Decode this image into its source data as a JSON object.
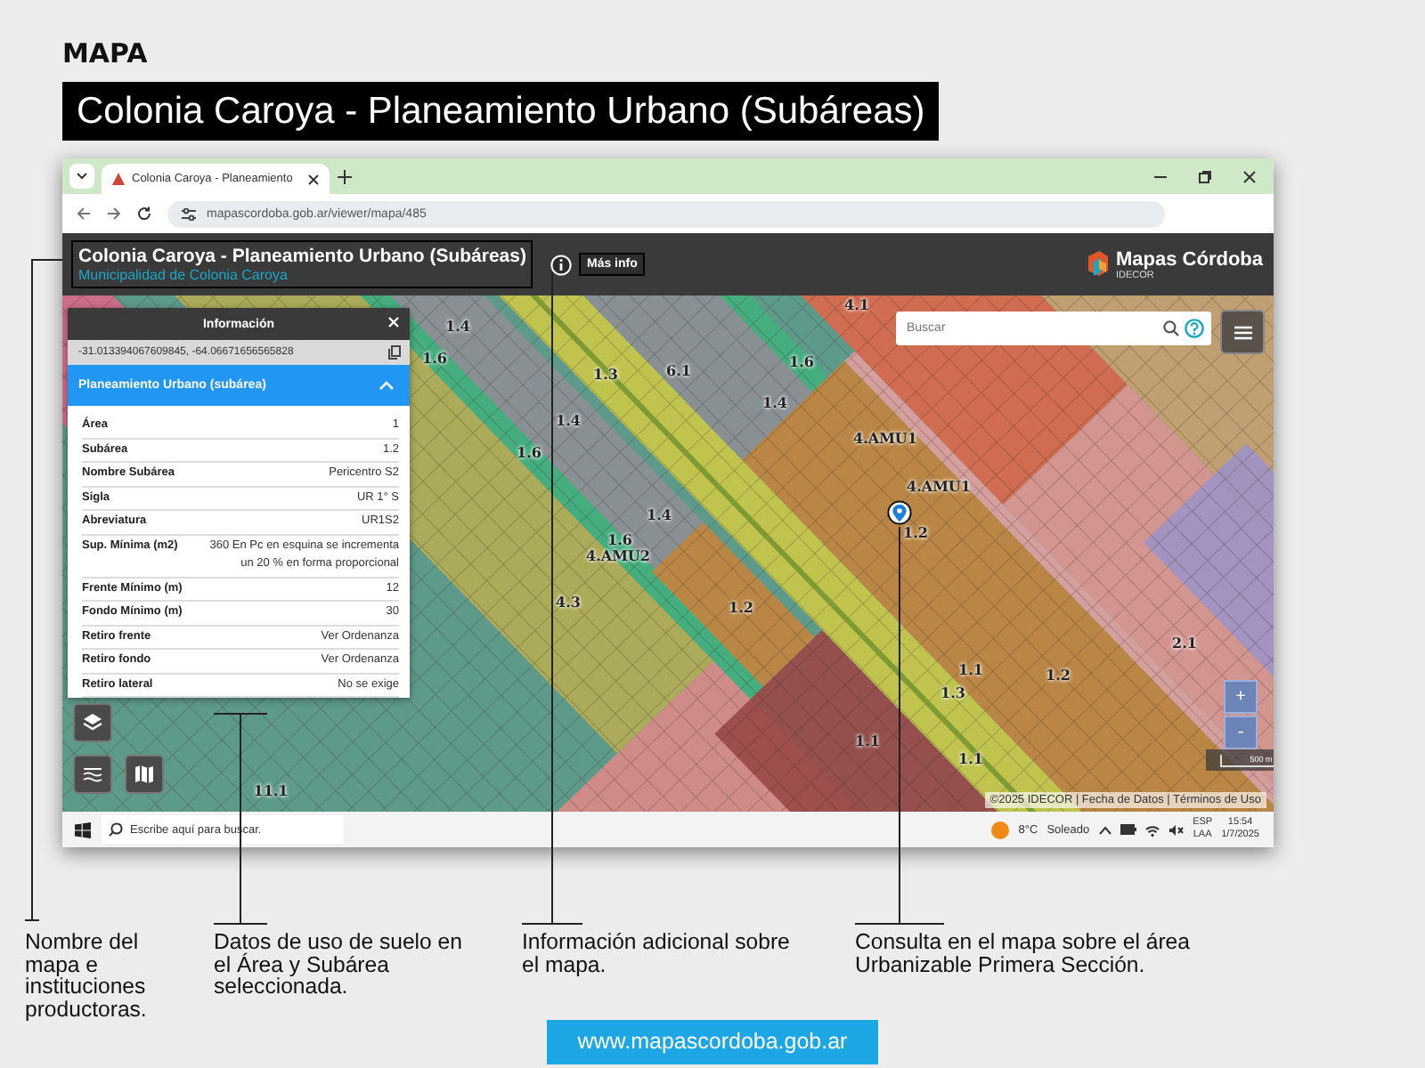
{
  "heading": "MAPA",
  "banner": "Colonia Caroya - Planeamiento Urbano (Subáreas)",
  "browser": {
    "tab": {
      "title": "Colonia Caroya - Planeamiento"
    },
    "url": "mapascordoba.gob.ar/viewer/mapa/485"
  },
  "app": {
    "title": "Colonia Caroya - Planeamiento Urbano (Subáreas)",
    "subtitle": "Municipalidad de Colonia Caroya",
    "more_info": "Más info",
    "logo": {
      "name": "Mapas Córdoba",
      "sub": "IDECOR"
    }
  },
  "info_panel": {
    "title": "Información",
    "coordinates": "-31.013394067609845, -64.06671656565828",
    "section": {
      "title": "Planeamiento Urbano (subárea)",
      "expanded": true
    },
    "rows": [
      {
        "label": "Área",
        "value": "1"
      },
      {
        "label": "Subárea",
        "value": "1.2"
      },
      {
        "label": "Nombre Subárea",
        "value": "Pericentro S2"
      },
      {
        "label": "Sigla",
        "value": "UR 1° S"
      },
      {
        "label": "Abreviatura",
        "value": "UR1S2"
      },
      {
        "label": "Sup. Mínima (m2)",
        "value": "360 En Pc en esquina se incrementa un 20 % en forma proporcional"
      },
      {
        "label": "Frente Mínimo (m)",
        "value": "12"
      },
      {
        "label": "Fondo Mínimo (m)",
        "value": "30"
      },
      {
        "label": "Retiro frente",
        "value": "Ver Ordenanza"
      },
      {
        "label": "Retiro fondo",
        "value": "Ver Ordenanza"
      },
      {
        "label": "Retiro lateral",
        "value": "No se exige"
      }
    ]
  },
  "search": {
    "placeholder": "Buscar"
  },
  "zone_labels": [
    "4.1",
    "1.4",
    "1.6",
    "1.3",
    "6.1",
    "1.6",
    "1.4",
    "1.4",
    "1.6",
    "4.AMU1",
    "4.AMU1",
    "1.4",
    "1.2",
    "1.6",
    "4.AMU2",
    "4.3",
    "1.2",
    "2.1",
    "1.1",
    "1.2",
    "1.3",
    "1.1",
    "1.1",
    "11.1"
  ],
  "zoom": {
    "in": "+",
    "out": "-"
  },
  "scale": "500 m",
  "attribution": "©2025 IDECOR | Fecha de Datos | Términos de Uso",
  "taskbar": {
    "search_placeholder": "Escribe aquí para buscar.",
    "temperature": "8°C",
    "weather": "Soleado",
    "language": "ESP",
    "region": "LAA",
    "time": "15:54",
    "date": "1/7/2025"
  },
  "annotations": [
    "Nombre del mapa e instituciones productoras.",
    "Datos de uso de suelo en el Área y Subárea seleccionada.",
    "Información adicional sobre el mapa.",
    "Consulta en el mapa sobre  el área Urbanizable Primera Sección."
  ],
  "footer_link": "www.mapascordoba.gob.ar"
}
